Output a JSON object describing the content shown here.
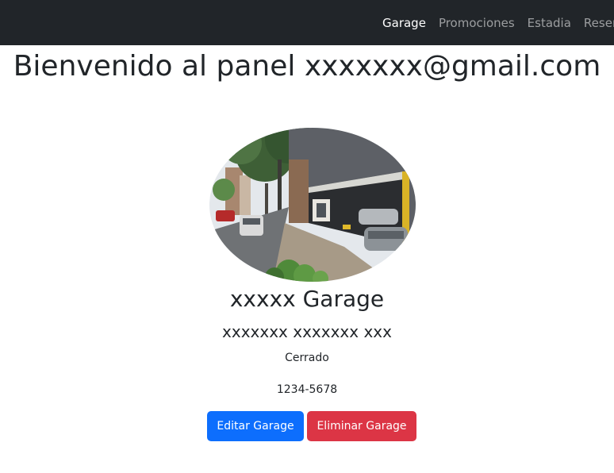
{
  "navbar": {
    "items": [
      {
        "label": "Garage",
        "active": true
      },
      {
        "label": "Promociones",
        "active": false
      },
      {
        "label": "Estadia",
        "active": false
      },
      {
        "label": "Reservas",
        "active": false
      }
    ]
  },
  "main": {
    "title": "Bienvenido al panel xxxxxxx@gmail.com",
    "garage": {
      "name": "xxxxx Garage",
      "address": "xxxxxxx xxxxxxx xxx",
      "status": "Cerrado",
      "phone": "1234-5678"
    },
    "actions": {
      "edit_label": "Editar Garage",
      "delete_label": "Eliminar Garage"
    }
  },
  "colors": {
    "navbar_bg": "#212529",
    "primary": "#0d6efd",
    "danger": "#dc3545"
  }
}
